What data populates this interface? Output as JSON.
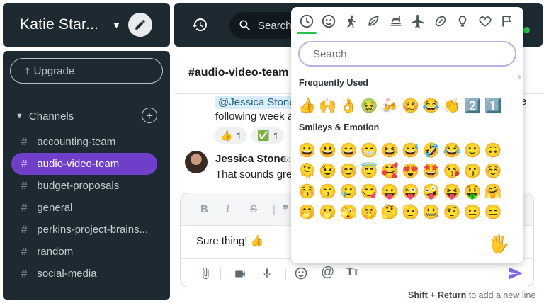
{
  "workspace": {
    "name": "Katie Star..."
  },
  "sidebar": {
    "upgrade_label": "Upgrade",
    "channels_label": "Channels",
    "channels": [
      {
        "name": "accounting-team",
        "active": false
      },
      {
        "name": "audio-video-team",
        "active": true
      },
      {
        "name": "budget-proposals",
        "active": false
      },
      {
        "name": "general",
        "active": false
      },
      {
        "name": "perkins-project-brains...",
        "active": false
      },
      {
        "name": "random",
        "active": false
      },
      {
        "name": "social-media",
        "active": false
      }
    ]
  },
  "topbar": {
    "search_label": "Search"
  },
  "chat": {
    "channel_title": "#audio-video-team",
    "message1": {
      "mention": "@Jessica Stone",
      "line1_tail": "e",
      "line2": "following week a"
    },
    "reactions": [
      {
        "emoji": "👍",
        "count": "1"
      },
      {
        "emoji": "✅",
        "count": "1"
      }
    ],
    "message2": {
      "author": "Jessica Stone",
      "time": "5:",
      "text": "That sounds grea"
    }
  },
  "composer": {
    "text": "Sure thing! 👍",
    "hint_keys": "Shift + Return",
    "hint_text": "to add a new line"
  },
  "emoji_picker": {
    "search_placeholder": "Search",
    "frequently_used_label": "Frequently Used",
    "frequently_used": [
      "👍",
      "🙌",
      "👌",
      "🤢",
      "🍻",
      "🥴",
      "😂",
      "👏",
      "2️⃣",
      "1️⃣"
    ],
    "smileys_label": "Smileys & Emotion",
    "smileys": [
      "😀",
      "😃",
      "😄",
      "😁",
      "😆",
      "😅",
      "🤣",
      "😂",
      "🙂",
      "🙃",
      "🫠",
      "😉",
      "😊",
      "😇",
      "🥰",
      "😍",
      "🤩",
      "😘",
      "😗",
      "☺️",
      "😚",
      "😙",
      "🥲",
      "😋",
      "😛",
      "😜",
      "🤪",
      "😝",
      "🤑",
      "🤗",
      "🤭",
      "🫢",
      "🫣",
      "🤫",
      "🤔",
      "🫡",
      "🤐",
      "🤨",
      "😐",
      "😑"
    ],
    "skin_tone": "🖐️",
    "accent_color": "#27c24c",
    "search_border_color": "#b9b0e6"
  },
  "colors": {
    "sidebar_bg": "#1e2a32",
    "active_channel": "#6f3fc9",
    "send_icon": "#7b68ee"
  }
}
